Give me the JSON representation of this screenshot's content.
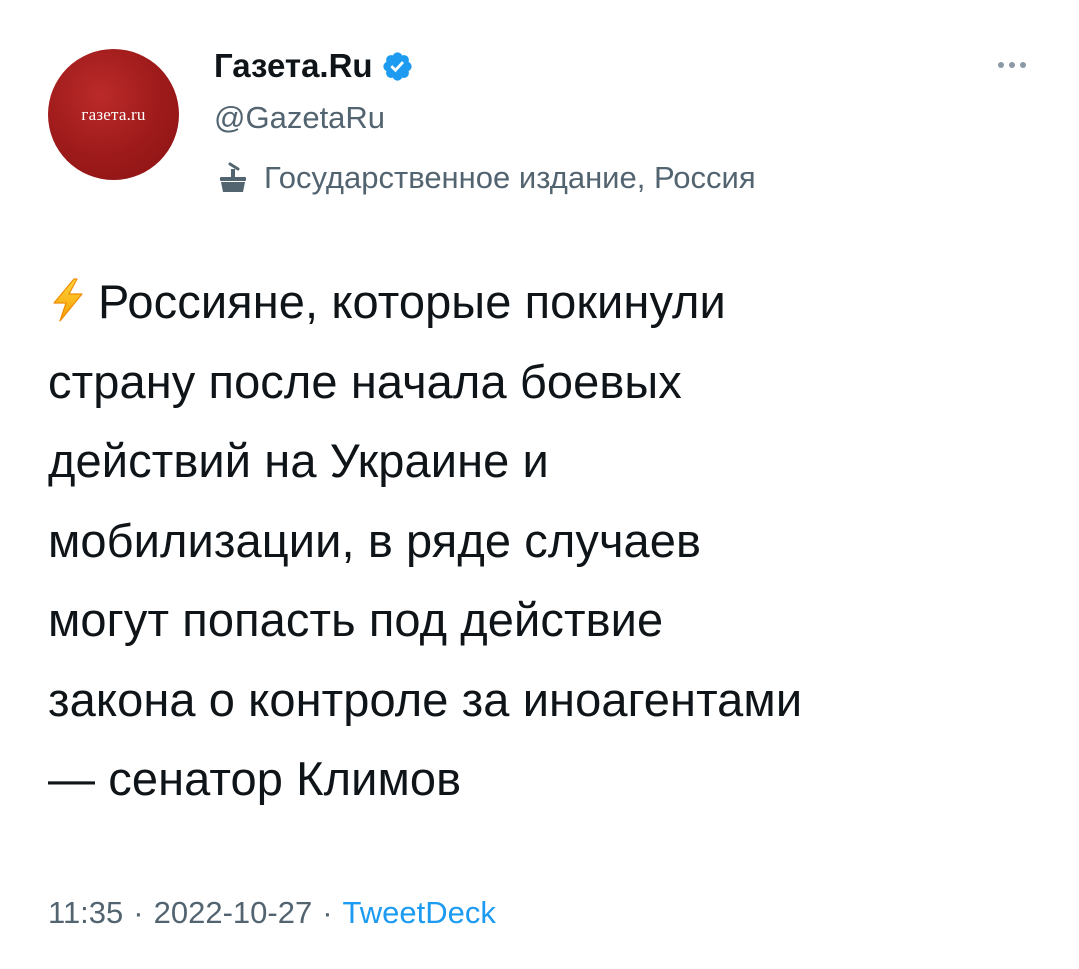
{
  "account": {
    "avatar_text": "газета.ru",
    "display_name": "Газета.Ru",
    "handle": "@GazetaRu",
    "label": "Государственное издание, Россия",
    "verified": true
  },
  "tweet": {
    "emoji_icon": "lightning-icon",
    "text": "Россияне, которые покинули\nстрану после начала боевых\nдействий на Украине и\nмобилизации, в ряде случаев\nмогут попасть под действие\nзакона о контроле за иноагентами\n— сенатор Климов",
    "time": "11:35",
    "date": "2022-10-27",
    "separator": "·",
    "source": "TweetDeck"
  },
  "colors": {
    "primary_text": "#0f1419",
    "secondary_text": "#536471",
    "link": "#1d9bf0",
    "avatar_bg": "#9d1a1a",
    "verified": "#1d9bf0"
  }
}
